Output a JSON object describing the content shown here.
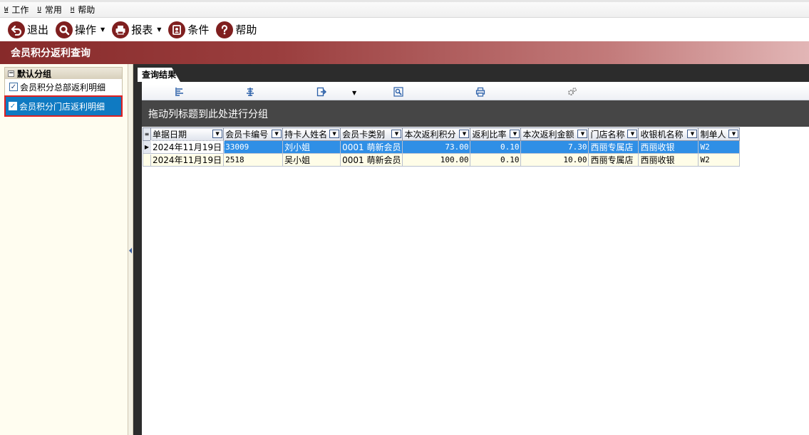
{
  "menu": [
    {
      "key": "W",
      "label": "工作"
    },
    {
      "key": "U",
      "label": "常用"
    },
    {
      "key": "H",
      "label": "帮助"
    }
  ],
  "toolbar": {
    "exit": "退出",
    "operate": "操作",
    "report": "报表",
    "condition": "条件",
    "help": "帮助"
  },
  "banner": {
    "title": "会员积分返利查询"
  },
  "left": {
    "group_title": "默认分组",
    "items": [
      {
        "label": "会员积分总部返利明细",
        "checked": true
      },
      {
        "label": "会员积分门店返利明细",
        "checked": true
      }
    ]
  },
  "tab": {
    "label": "查询结果"
  },
  "grid": {
    "group_hint": "拖动列标题到此处进行分组",
    "columns": [
      "单据日期",
      "会员卡编号",
      "持卡人姓名",
      "会员卡类别",
      "本次返利积分",
      "返利比率",
      "本次返利金额",
      "门店名称",
      "收银机名称",
      "制单人"
    ],
    "rows": [
      [
        "2024年11月19日",
        "33009",
        "刘小姐",
        "0001 萌新会员",
        "73.00",
        "0.10",
        "7.30",
        "西丽专属店",
        "西丽收银",
        "W2"
      ],
      [
        "2024年11月19日",
        "2518",
        "吴小姐",
        "0001 萌新会员",
        "100.00",
        "0.10",
        "10.00",
        "西丽专属店",
        "西丽收银",
        "W2"
      ]
    ]
  },
  "colors": {
    "banner": "#872a2a",
    "selection": "#2f8fe6",
    "icon": "#7f1f1f"
  }
}
